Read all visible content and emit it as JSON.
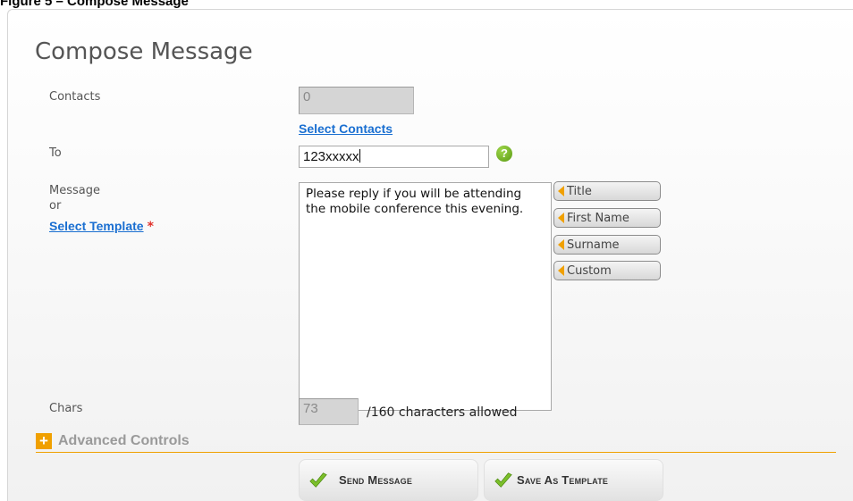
{
  "caption": "Figure 5 – Compose Message",
  "form": {
    "title": "Compose Message",
    "contacts_label": "Contacts",
    "contacts_value": "0",
    "select_contacts_link": "Select Contacts",
    "to_label": "To",
    "to_value": "123xxxxx",
    "help_icon_glyph": "?",
    "message_label": "Message",
    "or_label": "or",
    "select_template_link": "Select Template",
    "required_marker": "*",
    "message_text": "Please reply if you will be attending the mobile conference this evening.",
    "token_buttons": [
      "Title",
      "First Name",
      "Surname",
      "Custom"
    ],
    "chars_label": "Chars",
    "chars_value": "73",
    "chars_suffix": "/160 characters allowed",
    "advanced_plus": "+",
    "advanced_label": "Advanced Controls",
    "send_button": "Send Message",
    "save_template_button": "Save As Template"
  },
  "colors": {
    "link": "#1a6fd1",
    "accent_orange": "#f0a000",
    "check_green": "#7bbf2a",
    "required_red": "#e0312a"
  },
  "icons": {
    "help": "question-circle-icon",
    "token": "arrow-left-icon",
    "advanced": "plus-icon",
    "action": "checkmark-icon"
  }
}
